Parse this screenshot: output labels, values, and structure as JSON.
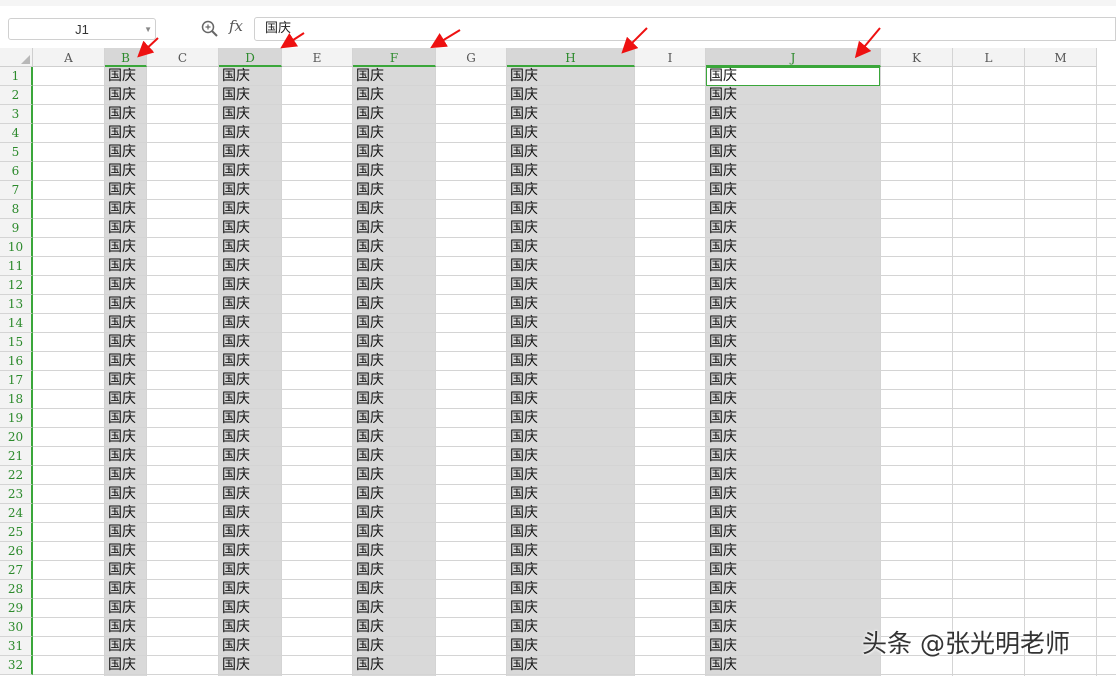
{
  "formula_bar": {
    "name_box": "J1",
    "zoom_icon": "zoom-formula-icon",
    "fx_label": "fx",
    "formula_value": "国庆"
  },
  "columns": [
    "A",
    "B",
    "C",
    "D",
    "E",
    "F",
    "G",
    "H",
    "I",
    "J",
    "K",
    "L",
    "M"
  ],
  "selected_columns": [
    "B",
    "D",
    "F",
    "H",
    "J"
  ],
  "rows": [
    "1",
    "2",
    "3",
    "4",
    "5",
    "6",
    "7",
    "8",
    "9",
    "10",
    "11",
    "12",
    "13",
    "14",
    "15",
    "16",
    "17",
    "18",
    "19",
    "20",
    "21",
    "22",
    "23",
    "24",
    "25",
    "26",
    "27",
    "28",
    "29",
    "30",
    "31",
    "32"
  ],
  "cell_text": "国庆",
  "active_cell": "J1",
  "colors": {
    "selection_green": "#3aa63a",
    "selection_shade": "#d9d9d9",
    "annotation_arrow": "#ee1111"
  },
  "watermark": "头条 @张光明老师"
}
